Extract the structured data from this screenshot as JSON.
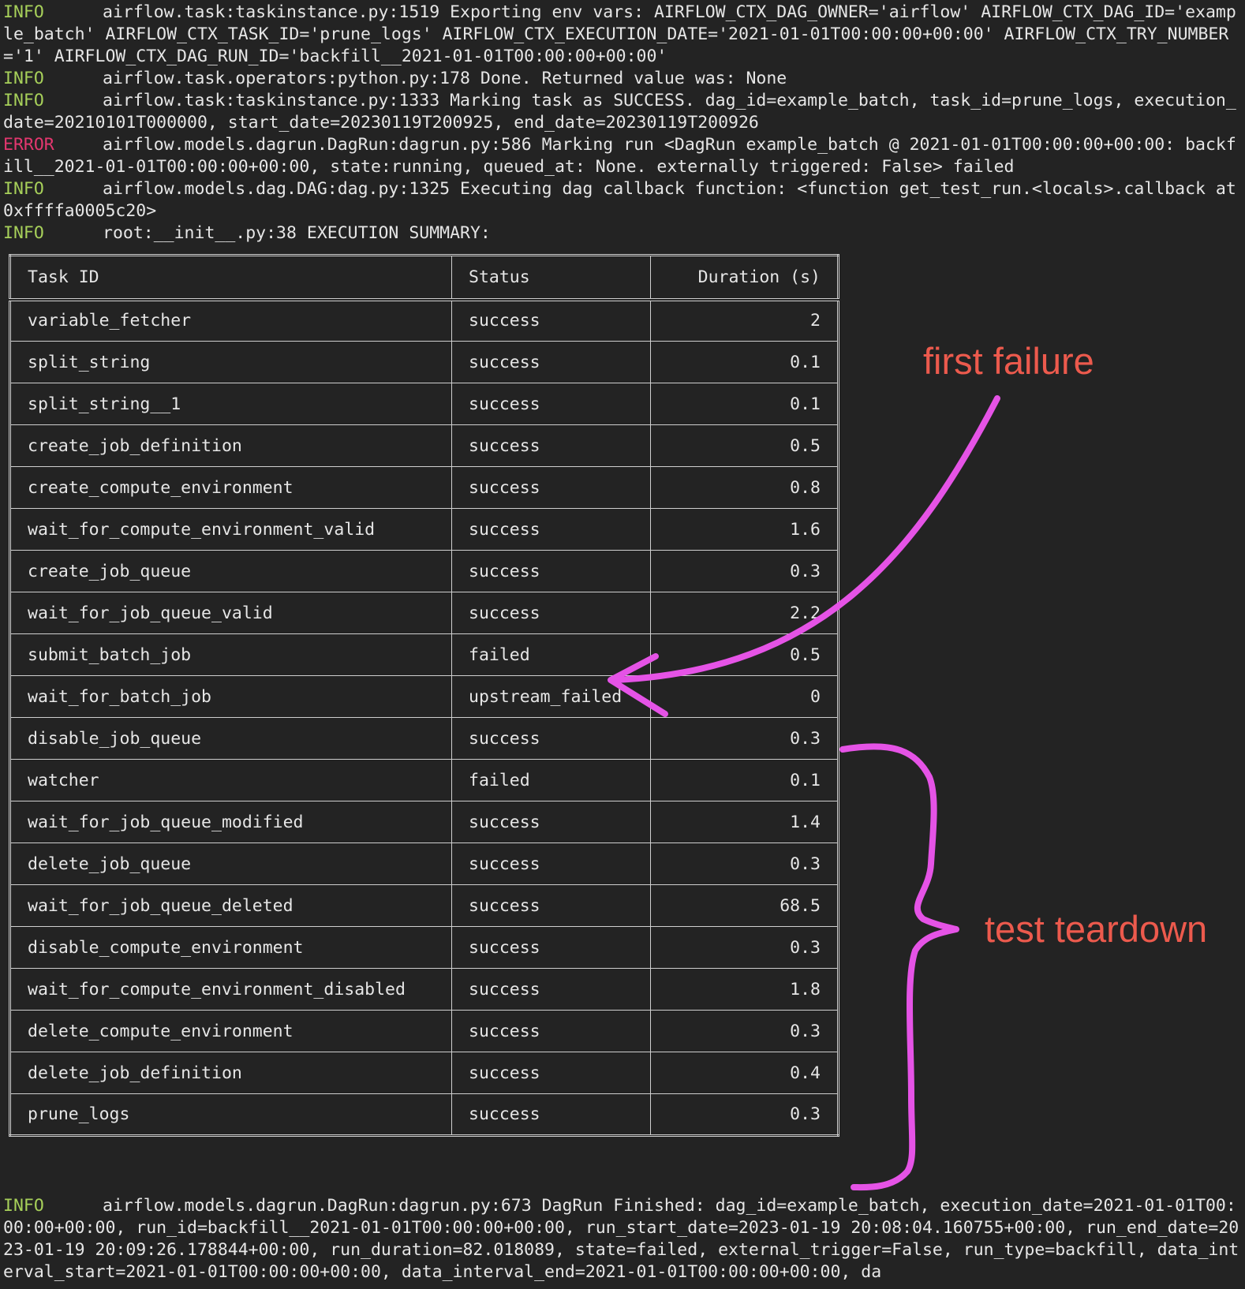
{
  "log_top": [
    {
      "level": "INFO",
      "message": "airflow.task:taskinstance.py:1519 Exporting env vars: AIRFLOW_CTX_DAG_OWNER='airflow' AIRFLOW_CTX_DAG_ID='example_batch' AIRFLOW_CTX_TASK_ID='prune_logs' AIRFLOW_CTX_EXECUTION_DATE='2021-01-01T00:00:00+00:00' AIRFLOW_CTX_TRY_NUMBER='1' AIRFLOW_CTX_DAG_RUN_ID='backfill__2021-01-01T00:00:00+00:00'"
    },
    {
      "level": "INFO",
      "message": "airflow.task.operators:python.py:178 Done. Returned value was: None"
    },
    {
      "level": "INFO",
      "message": "airflow.task:taskinstance.py:1333 Marking task as SUCCESS. dag_id=example_batch, task_id=prune_logs, execution_date=20210101T000000, start_date=20230119T200925, end_date=20230119T200926"
    },
    {
      "level": "ERROR",
      "message": "airflow.models.dagrun.DagRun:dagrun.py:586 Marking run <DagRun example_batch @ 2021-01-01T00:00:00+00:00: backfill__2021-01-01T00:00:00+00:00, state:running, queued_at: None. externally triggered: False> failed"
    },
    {
      "level": "INFO",
      "message": "airflow.models.dag.DAG:dag.py:1325 Executing dag callback function: <function get_test_run.<locals>.callback at 0xffffa0005c20>"
    },
    {
      "level": "INFO",
      "message": "root:__init__.py:38 EXECUTION SUMMARY:"
    }
  ],
  "table": {
    "headers": [
      "Task ID",
      "Status",
      "Duration (s)"
    ],
    "rows": [
      [
        "variable_fetcher",
        "success",
        "2"
      ],
      [
        "split_string",
        "success",
        "0.1"
      ],
      [
        "split_string__1",
        "success",
        "0.1"
      ],
      [
        "create_job_definition",
        "success",
        "0.5"
      ],
      [
        "create_compute_environment",
        "success",
        "0.8"
      ],
      [
        "wait_for_compute_environment_valid",
        "success",
        "1.6"
      ],
      [
        "create_job_queue",
        "success",
        "0.3"
      ],
      [
        "wait_for_job_queue_valid",
        "success",
        "2.2"
      ],
      [
        "submit_batch_job",
        "failed",
        "0.5"
      ],
      [
        "wait_for_batch_job",
        "upstream_failed",
        "0"
      ],
      [
        "disable_job_queue",
        "success",
        "0.3"
      ],
      [
        "watcher",
        "failed",
        "0.1"
      ],
      [
        "wait_for_job_queue_modified",
        "success",
        "1.4"
      ],
      [
        "delete_job_queue",
        "success",
        "0.3"
      ],
      [
        "wait_for_job_queue_deleted",
        "success",
        "68.5"
      ],
      [
        "disable_compute_environment",
        "success",
        "0.3"
      ],
      [
        "wait_for_compute_environment_disabled",
        "success",
        "1.8"
      ],
      [
        "delete_compute_environment",
        "success",
        "0.3"
      ],
      [
        "delete_job_definition",
        "success",
        "0.4"
      ],
      [
        "prune_logs",
        "success",
        "0.3"
      ]
    ]
  },
  "log_bottom": [
    {
      "level": "INFO",
      "message": "airflow.models.dagrun.DagRun:dagrun.py:673 DagRun Finished: dag_id=example_batch, execution_date=2021-01-01T00:00:00+00:00, run_id=backfill__2021-01-01T00:00:00+00:00, run_start_date=2023-01-19 20:08:04.160755+00:00, run_end_date=2023-01-19 20:09:26.178844+00:00, run_duration=82.018089, state=failed, external_trigger=False, run_type=backfill, data_interval_start=2021-01-01T00:00:00+00:00, data_interval_end=2021-01-01T00:00:00+00:00, da"
    }
  ],
  "annotations": {
    "first_failure": "first failure",
    "test_teardown": "test teardown"
  },
  "colors": {
    "info": "#a7d05a",
    "error": "#e3376f",
    "annotation_text": "#ec5a4d",
    "annotation_stroke": "#e553e6"
  },
  "icons": {
    "arrow": "curved-arrow-icon",
    "brace": "curly-brace-icon"
  }
}
